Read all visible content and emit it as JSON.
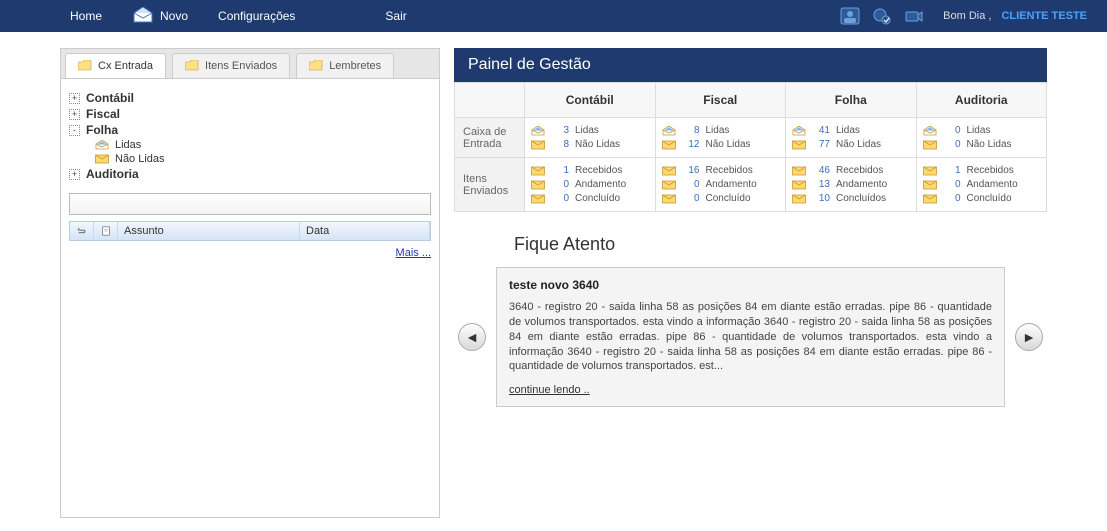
{
  "topbar": {
    "home": "Home",
    "novo": "Novo",
    "config": "Configurações",
    "sair": "Sair",
    "greeting": "Bom Dia ,",
    "user": "CLIENTE TESTE"
  },
  "tabs": {
    "inbox": "Cx Entrada",
    "sent": "Itens Enviados",
    "reminders": "Lembretes"
  },
  "tree": {
    "contabil": "Contábil",
    "fiscal": "Fiscal",
    "folha": "Folha",
    "folha_children": {
      "lidas": "Lidas",
      "nao_lidas": "Não Lidas"
    },
    "auditoria": "Auditoria"
  },
  "grid": {
    "assunto": "Assunto",
    "data": "Data"
  },
  "more": "Mais ...",
  "panel": {
    "title": "Painel de Gestão",
    "cols": {
      "contabil": "Contábil",
      "fiscal": "Fiscal",
      "folha": "Folha",
      "auditoria": "Auditoria"
    },
    "rows": {
      "inbox": "Caixa de Entrada",
      "sent": "Itens Enviados"
    },
    "labels": {
      "lidas": "Lidas",
      "nao_lidas": "Não Lidas",
      "recebidos": "Recebidos",
      "andamento": "Andamento",
      "concluido": "Concluído",
      "concluidos": "Concluídos"
    },
    "data": {
      "inbox": {
        "contabil": {
          "lidas": 3,
          "nao_lidas": 8
        },
        "fiscal": {
          "lidas": 8,
          "nao_lidas": 12
        },
        "folha": {
          "lidas": 41,
          "nao_lidas": 77
        },
        "auditoria": {
          "lidas": 0,
          "nao_lidas": 0
        }
      },
      "sent": {
        "contabil": {
          "recebidos": 1,
          "andamento": 0,
          "concluido": 0
        },
        "fiscal": {
          "recebidos": 16,
          "andamento": 0,
          "concluido": 0
        },
        "folha": {
          "recebidos": 46,
          "andamento": 13,
          "concluido": 10
        },
        "auditoria": {
          "recebidos": 1,
          "andamento": 0,
          "concluido": 0
        }
      }
    }
  },
  "attention": {
    "heading": "Fique Atento",
    "title": "teste novo 3640",
    "body": "3640 - registro 20 - saida linha 58 as posições 84 em diante estão erradas. pipe 86 - quantidade de volumos transportados. esta vindo a informação 3640 - registro 20 - saida linha 58 as posições 84 em diante estão erradas. pipe 86 - quantidade de volumos transportados. esta vindo a informação 3640 - registro 20 - saida linha 58 as posições 84 em diante estão erradas. pipe 86 - quantidade de volumos transportados. est...",
    "more": "continue lendo .."
  }
}
